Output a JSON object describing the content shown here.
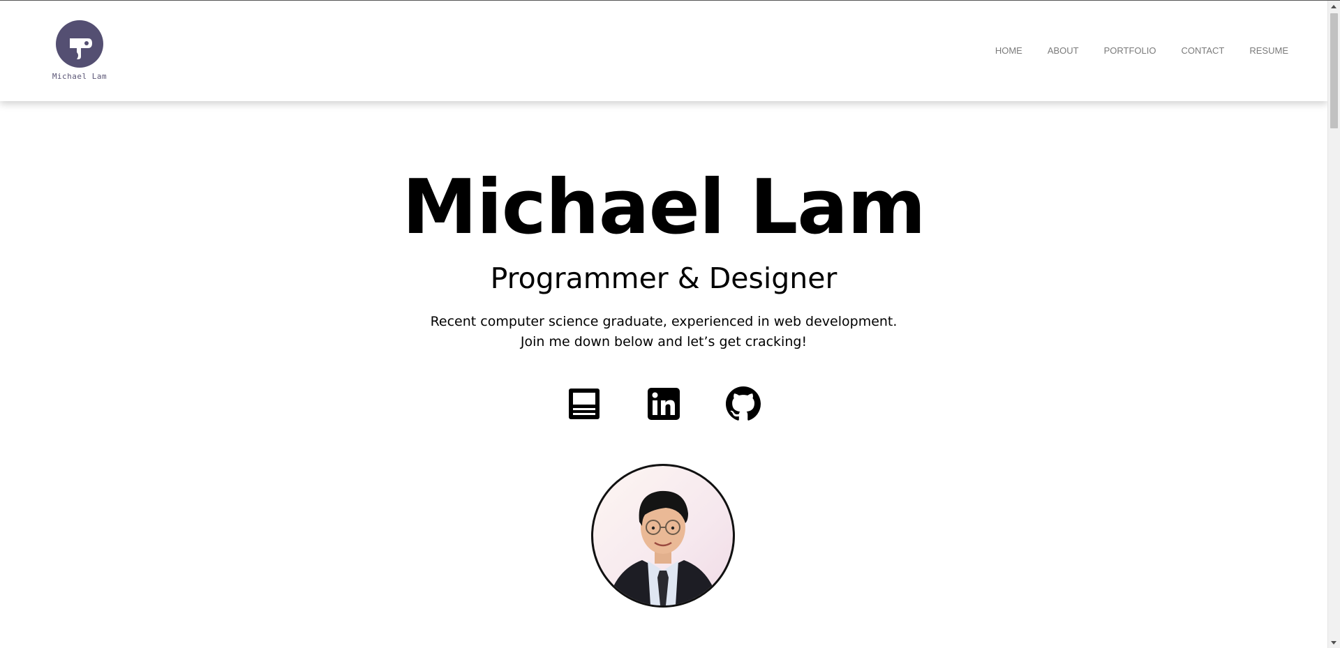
{
  "site": {
    "logo_text": "Michael Lam",
    "brand_color": "#544f72"
  },
  "nav": {
    "items": [
      {
        "label": "HOME"
      },
      {
        "label": "ABOUT"
      },
      {
        "label": "PORTFOLIO"
      },
      {
        "label": "CONTACT"
      },
      {
        "label": "RESUME"
      }
    ]
  },
  "hero": {
    "name": "Michael Lam",
    "role": "Programmer & Designer",
    "description_line1": "Recent computer science graduate, experienced in web development.",
    "description_line2": "Join me down below and let’s get cracking!"
  },
  "social": [
    {
      "icon": "resume-icon"
    },
    {
      "icon": "linkedin-icon"
    },
    {
      "icon": "github-icon"
    }
  ],
  "profile_photo": {
    "icon": "profile-photo"
  }
}
